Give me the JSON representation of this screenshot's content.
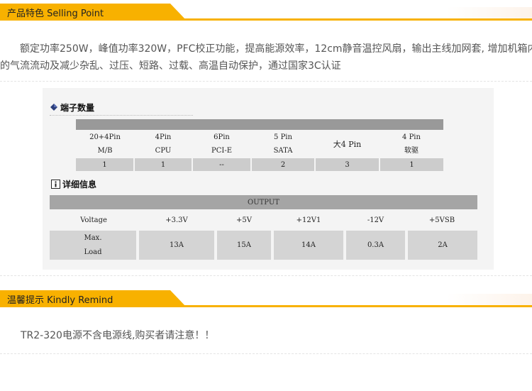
{
  "section1": {
    "title": "产品特色 Selling Point"
  },
  "description": {
    "line1": "额定功率250W，峰值功率320W，PFC校正功能，提高能源效率，12cm静音温控风扇，输出主线加网套, 增加机箱内",
    "line2": "的气流流动及减少杂乱、过压、短路、过载、高温自动保护，通过国家3C认证"
  },
  "connectors": {
    "title": "端子数量",
    "headers": [
      {
        "line1": "20+4Pin",
        "line2": "M/B"
      },
      {
        "line1": "4Pin",
        "line2": "CPU"
      },
      {
        "line1": "6Pin",
        "line2": "PCI-E"
      },
      {
        "line1": "5 Pin",
        "line2": "SATA"
      },
      {
        "line1": "大4 Pin",
        "line2": ""
      },
      {
        "line1": "4 Pin",
        "line2": "软驱"
      }
    ],
    "values": [
      "1",
      "1",
      "--",
      "2",
      "3",
      "1"
    ]
  },
  "details": {
    "title": "详细信息",
    "output_label": "OUTPUT",
    "row_label_voltage": "Voltage",
    "row_label_load_1": "Max.",
    "row_label_load_2": "Load",
    "voltages": [
      "+3.3V",
      "+5V",
      "+12V1",
      "-12V",
      "+5VSB"
    ],
    "loads": [
      "13A",
      "15A",
      "14A",
      "0.3A",
      "2A"
    ]
  },
  "section2": {
    "title": "温馨提示 Kindly Remind"
  },
  "reminder": {
    "text": "TR2-320电源不含电源线,购买者请注意！！"
  },
  "colors": {
    "accent": "#f8b100",
    "table_bar": "#999999",
    "cell": "#cccccc"
  }
}
